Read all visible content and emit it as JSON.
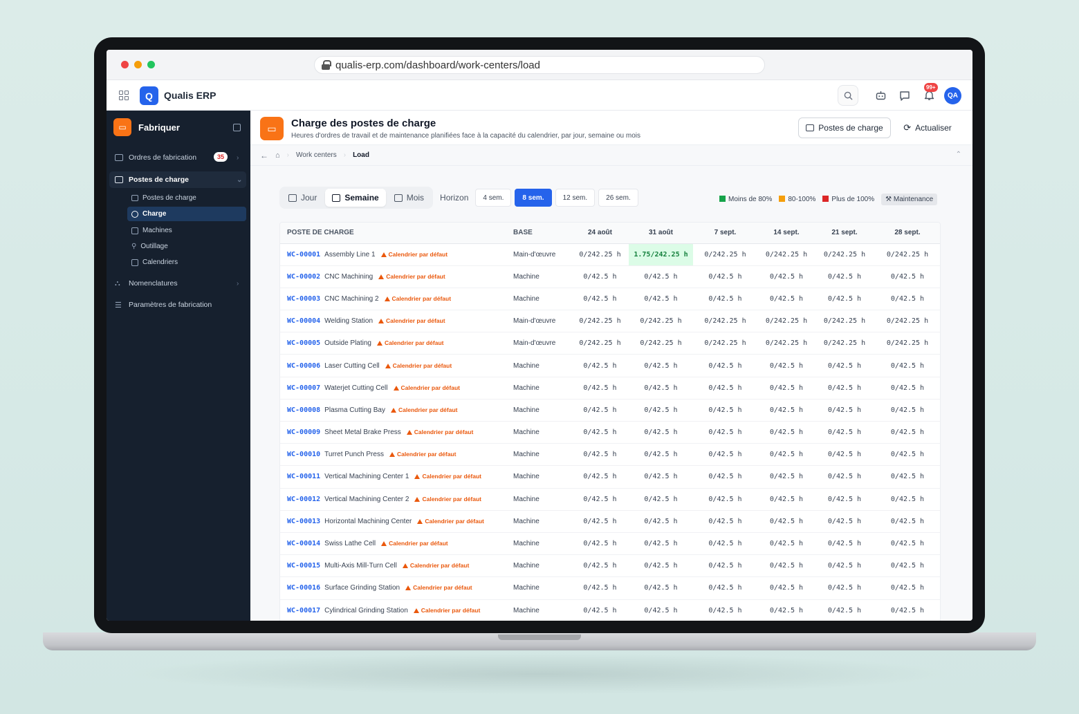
{
  "browser": {
    "url": "qualis-erp.com/dashboard/work-centers/load",
    "dots": [
      "#ef4444",
      "#f59e0b",
      "#22c55e"
    ]
  },
  "app": {
    "brand": "Qualis ERP",
    "logo_letter": "Q",
    "notif_count": "99+",
    "avatar_initials": "QA"
  },
  "sidebar": {
    "title": "Fabriquer",
    "items": [
      {
        "label": "Ordres de fabrication",
        "count": "35"
      },
      {
        "label": "Postes de charge"
      },
      {
        "label": "Nomenclatures"
      },
      {
        "label": "Paramètres de fabrication"
      }
    ],
    "subitems": [
      {
        "label": "Postes de charge"
      },
      {
        "label": "Charge"
      },
      {
        "label": "Machines"
      },
      {
        "label": "Outillage"
      },
      {
        "label": "Calendriers"
      }
    ]
  },
  "header": {
    "title": "Charge des postes de charge",
    "subtitle": "Heures d'ordres de travail et de maintenance planifiées face à la capacité du calendrier, par jour, semaine ou mois",
    "primary_button": "Postes de charge",
    "refresh_button": "Actualiser"
  },
  "breadcrumb": {
    "items": [
      "Work centers",
      "Load"
    ]
  },
  "toolbar": {
    "views": [
      "Jour",
      "Semaine",
      "Mois"
    ],
    "active_view": "Semaine",
    "horizon_label": "Horizon",
    "horizons": [
      "4 sem.",
      "8 sem.",
      "12 sem.",
      "26 sem."
    ],
    "active_horizon": "8 sem."
  },
  "legend": {
    "items": [
      {
        "label": "Moins de 80%",
        "color": "#16a34a"
      },
      {
        "label": "80-100%",
        "color": "#f59e0b"
      },
      {
        "label": "Plus de 100%",
        "color": "#dc2626"
      }
    ],
    "maintenance": "Maintenance"
  },
  "table": {
    "headers": {
      "work_center": "POSTE DE CHARGE",
      "base": "BASE"
    },
    "weeks": [
      "24 août",
      "31 août",
      "7 sept.",
      "14 sept.",
      "21 sept.",
      "28 sept."
    ],
    "calendar_tag": "Calendrier par défaut",
    "rows": [
      {
        "code": "WC-00001",
        "name": "Assembly Line 1",
        "base": "Main-d'œuvre",
        "values": [
          "0/242.25 h",
          "1.75/242.25 h",
          "0/242.25 h",
          "0/242.25 h",
          "0/242.25 h",
          "0/242.25 h"
        ],
        "highlight": 1
      },
      {
        "code": "WC-00002",
        "name": "CNC Machining",
        "base": "Machine",
        "values": [
          "0/42.5 h",
          "0/42.5 h",
          "0/42.5 h",
          "0/42.5 h",
          "0/42.5 h",
          "0/42.5 h"
        ]
      },
      {
        "code": "WC-00003",
        "name": "CNC Machining 2",
        "base": "Machine",
        "values": [
          "0/42.5 h",
          "0/42.5 h",
          "0/42.5 h",
          "0/42.5 h",
          "0/42.5 h",
          "0/42.5 h"
        ]
      },
      {
        "code": "WC-00004",
        "name": "Welding Station",
        "base": "Main-d'œuvre",
        "values": [
          "0/242.25 h",
          "0/242.25 h",
          "0/242.25 h",
          "0/242.25 h",
          "0/242.25 h",
          "0/242.25 h"
        ]
      },
      {
        "code": "WC-00005",
        "name": "Outside Plating",
        "base": "Main-d'œuvre",
        "values": [
          "0/242.25 h",
          "0/242.25 h",
          "0/242.25 h",
          "0/242.25 h",
          "0/242.25 h",
          "0/242.25 h"
        ]
      },
      {
        "code": "WC-00006",
        "name": "Laser Cutting Cell",
        "base": "Machine",
        "values": [
          "0/42.5 h",
          "0/42.5 h",
          "0/42.5 h",
          "0/42.5 h",
          "0/42.5 h",
          "0/42.5 h"
        ]
      },
      {
        "code": "WC-00007",
        "name": "Waterjet Cutting Cell",
        "base": "Machine",
        "values": [
          "0/42.5 h",
          "0/42.5 h",
          "0/42.5 h",
          "0/42.5 h",
          "0/42.5 h",
          "0/42.5 h"
        ]
      },
      {
        "code": "WC-00008",
        "name": "Plasma Cutting Bay",
        "base": "Machine",
        "values": [
          "0/42.5 h",
          "0/42.5 h",
          "0/42.5 h",
          "0/42.5 h",
          "0/42.5 h",
          "0/42.5 h"
        ]
      },
      {
        "code": "WC-00009",
        "name": "Sheet Metal Brake Press",
        "base": "Machine",
        "values": [
          "0/42.5 h",
          "0/42.5 h",
          "0/42.5 h",
          "0/42.5 h",
          "0/42.5 h",
          "0/42.5 h"
        ]
      },
      {
        "code": "WC-00010",
        "name": "Turret Punch Press",
        "base": "Machine",
        "values": [
          "0/42.5 h",
          "0/42.5 h",
          "0/42.5 h",
          "0/42.5 h",
          "0/42.5 h",
          "0/42.5 h"
        ]
      },
      {
        "code": "WC-00011",
        "name": "Vertical Machining Center 1",
        "base": "Machine",
        "values": [
          "0/42.5 h",
          "0/42.5 h",
          "0/42.5 h",
          "0/42.5 h",
          "0/42.5 h",
          "0/42.5 h"
        ]
      },
      {
        "code": "WC-00012",
        "name": "Vertical Machining Center 2",
        "base": "Machine",
        "values": [
          "0/42.5 h",
          "0/42.5 h",
          "0/42.5 h",
          "0/42.5 h",
          "0/42.5 h",
          "0/42.5 h"
        ]
      },
      {
        "code": "WC-00013",
        "name": "Horizontal Machining Center",
        "base": "Machine",
        "values": [
          "0/42.5 h",
          "0/42.5 h",
          "0/42.5 h",
          "0/42.5 h",
          "0/42.5 h",
          "0/42.5 h"
        ]
      },
      {
        "code": "WC-00014",
        "name": "Swiss Lathe Cell",
        "base": "Machine",
        "values": [
          "0/42.5 h",
          "0/42.5 h",
          "0/42.5 h",
          "0/42.5 h",
          "0/42.5 h",
          "0/42.5 h"
        ]
      },
      {
        "code": "WC-00015",
        "name": "Multi-Axis Mill-Turn Cell",
        "base": "Machine",
        "values": [
          "0/42.5 h",
          "0/42.5 h",
          "0/42.5 h",
          "0/42.5 h",
          "0/42.5 h",
          "0/42.5 h"
        ]
      },
      {
        "code": "WC-00016",
        "name": "Surface Grinding Station",
        "base": "Machine",
        "values": [
          "0/42.5 h",
          "0/42.5 h",
          "0/42.5 h",
          "0/42.5 h",
          "0/42.5 h",
          "0/42.5 h"
        ]
      },
      {
        "code": "WC-00017",
        "name": "Cylindrical Grinding Station",
        "base": "Machine",
        "values": [
          "0/42.5 h",
          "0/42.5 h",
          "0/42.5 h",
          "0/42.5 h",
          "0/42.5 h",
          "0/42.5 h"
        ]
      }
    ]
  }
}
